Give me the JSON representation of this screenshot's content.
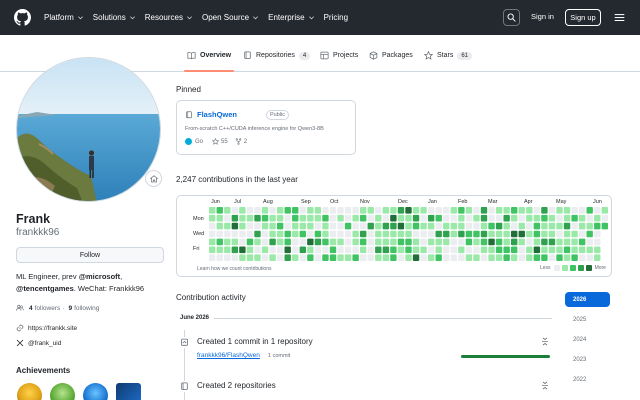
{
  "header": {
    "nav": [
      {
        "label": "Platform",
        "dropdown": true
      },
      {
        "label": "Solutions",
        "dropdown": true
      },
      {
        "label": "Resources",
        "dropdown": true
      },
      {
        "label": "Open Source",
        "dropdown": true
      },
      {
        "label": "Enterprise",
        "dropdown": true
      },
      {
        "label": "Pricing",
        "dropdown": false
      }
    ],
    "sign_in": "Sign in",
    "sign_up": "Sign up"
  },
  "tabs": [
    {
      "label": "Overview",
      "count": "",
      "icon": "book-icon",
      "active": true
    },
    {
      "label": "Repositories",
      "count": "4",
      "icon": "repo-icon",
      "active": false
    },
    {
      "label": "Projects",
      "count": "",
      "icon": "table-icon",
      "active": false
    },
    {
      "label": "Packages",
      "count": "",
      "icon": "package-icon",
      "active": false
    },
    {
      "label": "Stars",
      "count": "61",
      "icon": "star-icon",
      "active": false
    }
  ],
  "profile": {
    "name": "Frank",
    "login": "frankkk96",
    "follow_label": "Follow",
    "bio_line1_prefix": "ML Engineer, prev ",
    "bio_org1": "@microsoft",
    "bio_line1_suffix": ",",
    "bio_org2": "@tencentgames",
    "bio_line2_suffix": ". WeChat: Frankkk96",
    "followers_count": "4",
    "followers_label": "followers",
    "separator": "·",
    "following_count": "9",
    "following_label": "following",
    "website": "https://frankk.site",
    "x_handle": "@frank_uid",
    "achievements_title": "Achievements"
  },
  "pinned": {
    "title": "Pinned",
    "repos": [
      {
        "name": "FlashQwen",
        "visibility": "Public",
        "description": "From-scratch C++/CUDA inference engine for Qwen3-8B",
        "language": "Go",
        "language_color": "#00ADD8",
        "stars": "55",
        "forks": "2"
      }
    ]
  },
  "contributions": {
    "title": "2,247 contributions in the last year",
    "months": [
      "Jun",
      "Jul",
      "Aug",
      "Sep",
      "Oct",
      "Nov",
      "Dec",
      "Jan",
      "Feb",
      "Mar",
      "Apr",
      "May",
      "Jun"
    ],
    "days": [
      "Mon",
      "Wed",
      "Fri"
    ],
    "footer": "Learn how we count contributions",
    "legend_less": "Less",
    "legend_more": "More",
    "colors": [
      "#ebedf0",
      "#9be9a8",
      "#40c463",
      "#30a14e",
      "#216e39"
    ]
  },
  "activity": {
    "title": "Contribution activity",
    "years": [
      "2026",
      "2025",
      "2024",
      "2023",
      "2022"
    ],
    "active_year": "2026",
    "month_label": "June 2026",
    "items": [
      {
        "text": "Created 1 commit in 1 repository",
        "repo": "frankkk96/FlashQwen",
        "detail": "1 commit"
      },
      {
        "text": "Created 2 repositories"
      }
    ]
  }
}
